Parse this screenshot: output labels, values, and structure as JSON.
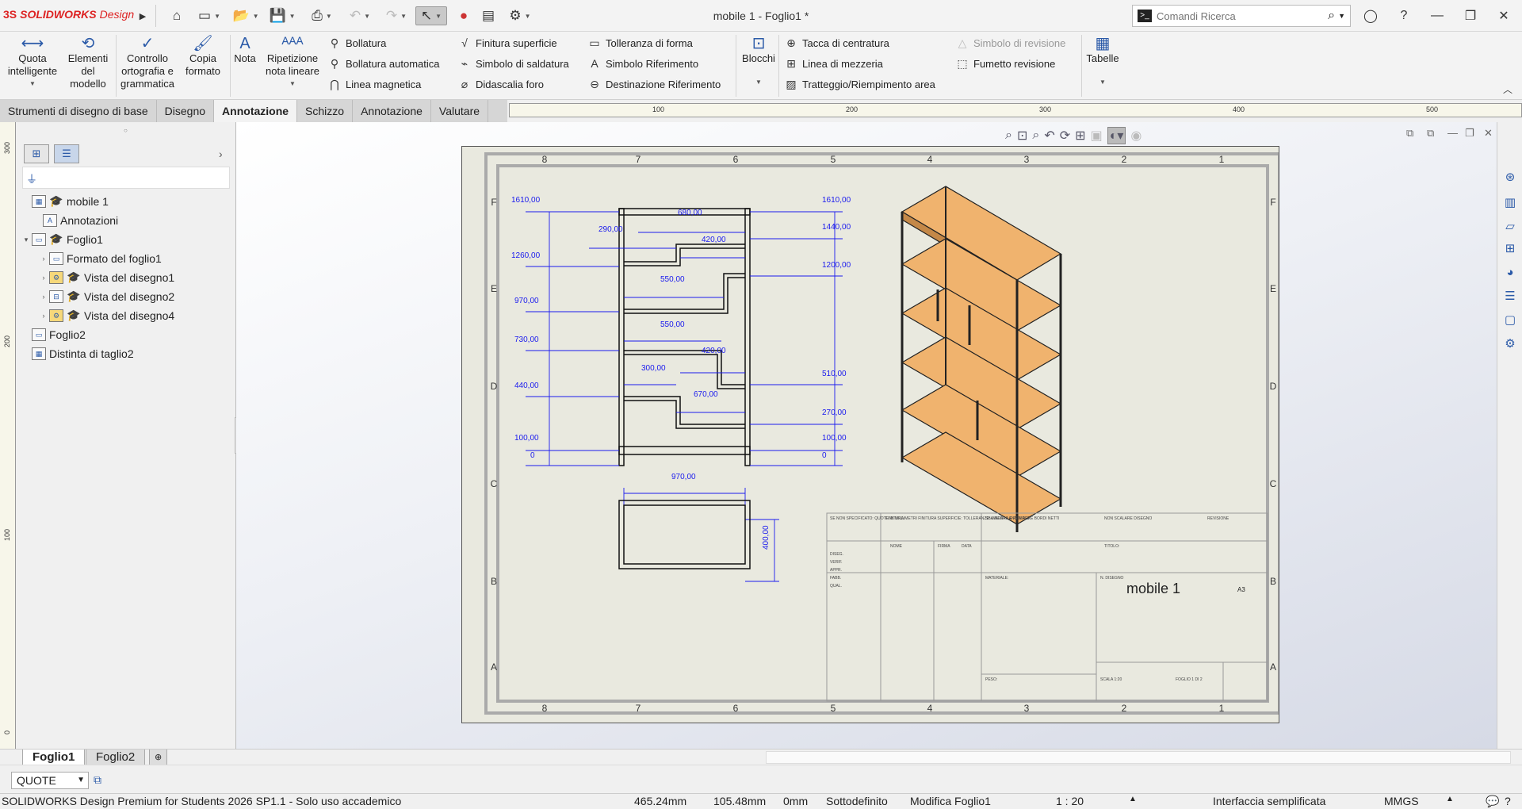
{
  "app": {
    "logo_ds": "3S",
    "logo_brand": "SOLIDWORKS",
    "logo_design": "Design",
    "document_title": "mobile 1 - Foglio1 *"
  },
  "search": {
    "placeholder": "Comandi Ricerca"
  },
  "ribbon": {
    "big": [
      {
        "label": "Quota intelligente",
        "icon": "smart-dimension-icon"
      },
      {
        "label": "Elementi del modello",
        "icon": "model-items-icon"
      },
      {
        "label": "Controllo ortografia e grammatica",
        "icon": "spell-check-icon"
      },
      {
        "label": "Copia formato",
        "icon": "format-painter-icon"
      },
      {
        "label": "Nota",
        "icon": "note-icon"
      },
      {
        "label": "Ripetizione nota lineare",
        "icon": "linear-note-pattern-icon"
      },
      {
        "label": "Blocchi",
        "icon": "blocks-icon"
      },
      {
        "label": "Tabelle",
        "icon": "tables-icon"
      }
    ],
    "small": {
      "bollatura": "Bollatura",
      "bollatura_auto": "Bollatura automatica",
      "linea_magnetica": "Linea magnetica",
      "finitura": "Finitura superficie",
      "saldatura": "Simbolo di saldatura",
      "didascalia": "Didascalia foro",
      "tolleranza": "Tolleranza di forma",
      "simbolo_rif": "Simbolo Riferimento",
      "destinazione_rif": "Destinazione Riferimento",
      "tacca": "Tacca di centratura",
      "mezzeria": "Linea di mezzeria",
      "tratteggio": "Tratteggio/Riempimento area",
      "simbolo_revisione": "Simbolo di revisione",
      "fumetto_revisione": "Fumetto revisione"
    }
  },
  "tabs": [
    "Strumenti di disegno di base",
    "Disegno",
    "Annotazione",
    "Schizzo",
    "Annotazione",
    "Valutare"
  ],
  "active_tab": "Annotazione",
  "ruler_top": [
    "100",
    "200",
    "300",
    "400",
    "500"
  ],
  "ruler_left": [
    "300",
    "200",
    "100",
    "0"
  ],
  "tree": [
    {
      "label": "mobile 1",
      "level": 0,
      "expander": ""
    },
    {
      "label": "Annotazioni",
      "level": 1,
      "expander": ""
    },
    {
      "label": "Foglio1",
      "level": 0,
      "expander": "▾"
    },
    {
      "label": "Formato del foglio1",
      "level": 1,
      "expander": "›"
    },
    {
      "label": "Vista del disegno1",
      "level": 1,
      "expander": "›"
    },
    {
      "label": "Vista del disegno2",
      "level": 1,
      "expander": "›"
    },
    {
      "label": "Vista del disegno4",
      "level": 1,
      "expander": "›"
    },
    {
      "label": "Foglio2",
      "level": 0,
      "expander": ""
    },
    {
      "label": "Distinta di taglio2",
      "level": 0,
      "expander": ""
    }
  ],
  "sheet": {
    "col_labels": [
      "8",
      "7",
      "6",
      "5",
      "4",
      "3",
      "2",
      "1"
    ],
    "row_labels": [
      "F",
      "E",
      "D",
      "C",
      "B",
      "A"
    ],
    "left_dims": [
      "1610,00",
      "1260,00",
      "970,00",
      "730,00",
      "440,00",
      "100,00",
      "0"
    ],
    "right_dims": [
      "1610,00",
      "1440,00",
      "1200,00",
      "510,00",
      "270,00",
      "100,00",
      "0"
    ],
    "inner_dims": [
      "680,00",
      "290,00",
      "420,00",
      "550,00",
      "550,00",
      "420,00",
      "300,00",
      "670,00"
    ],
    "top_view_width": "970,00",
    "top_view_depth": "400,00",
    "title_block_name": "mobile 1",
    "title_block_size": "A3",
    "title_block_labels": {
      "finish": "SE NON SPECIFICATO: QUOTE IN MILLIMETRI FINITURA SUPERFICIE: TOLLERANZE: LINEARI: ANGOLARI:",
      "finitura": "FINITURA:",
      "sbavatura": "SBAVATURA E ROMPERE BORDI NETTI",
      "non_scalare": "NON SCALARE DISEGNO",
      "revisione": "REVISIONE",
      "nome": "NOME",
      "firma": "FIRMA",
      "data": "DATA",
      "titolo": "TITOLO:",
      "disegnato": "DISEG.",
      "verificato": "VERIF.",
      "approvato": "APPR.",
      "fabbricazione": "FABB.",
      "qualita": "QUAL.",
      "materiale": "MATERIALE:",
      "n_disegno": "N. DISEGNO",
      "peso": "PESO:",
      "scala": "SCALA 1:20",
      "foglio": "FOGLIO 1 DI 2"
    }
  },
  "sheet_tabs": [
    "Foglio1",
    "Foglio2"
  ],
  "active_sheet": "Foglio1",
  "layer": {
    "value": "QUOTE"
  },
  "status": {
    "product": "SOLIDWORKS Design Premium for Students 2026 SP1.1 - Solo uso accademico",
    "x": "465.24mm",
    "y": "105.48mm",
    "z": "0mm",
    "state": "Sottodefinito",
    "editing": "Modifica Foglio1",
    "scale": "1 : 20",
    "interface": "Interfaccia semplificata",
    "units": "MMGS"
  },
  "colors": {
    "dim_blue": "#1a1aee",
    "wood": "#f0b36e",
    "frame": "#1a1a1a",
    "sheet_bg": "#e9e9df"
  }
}
